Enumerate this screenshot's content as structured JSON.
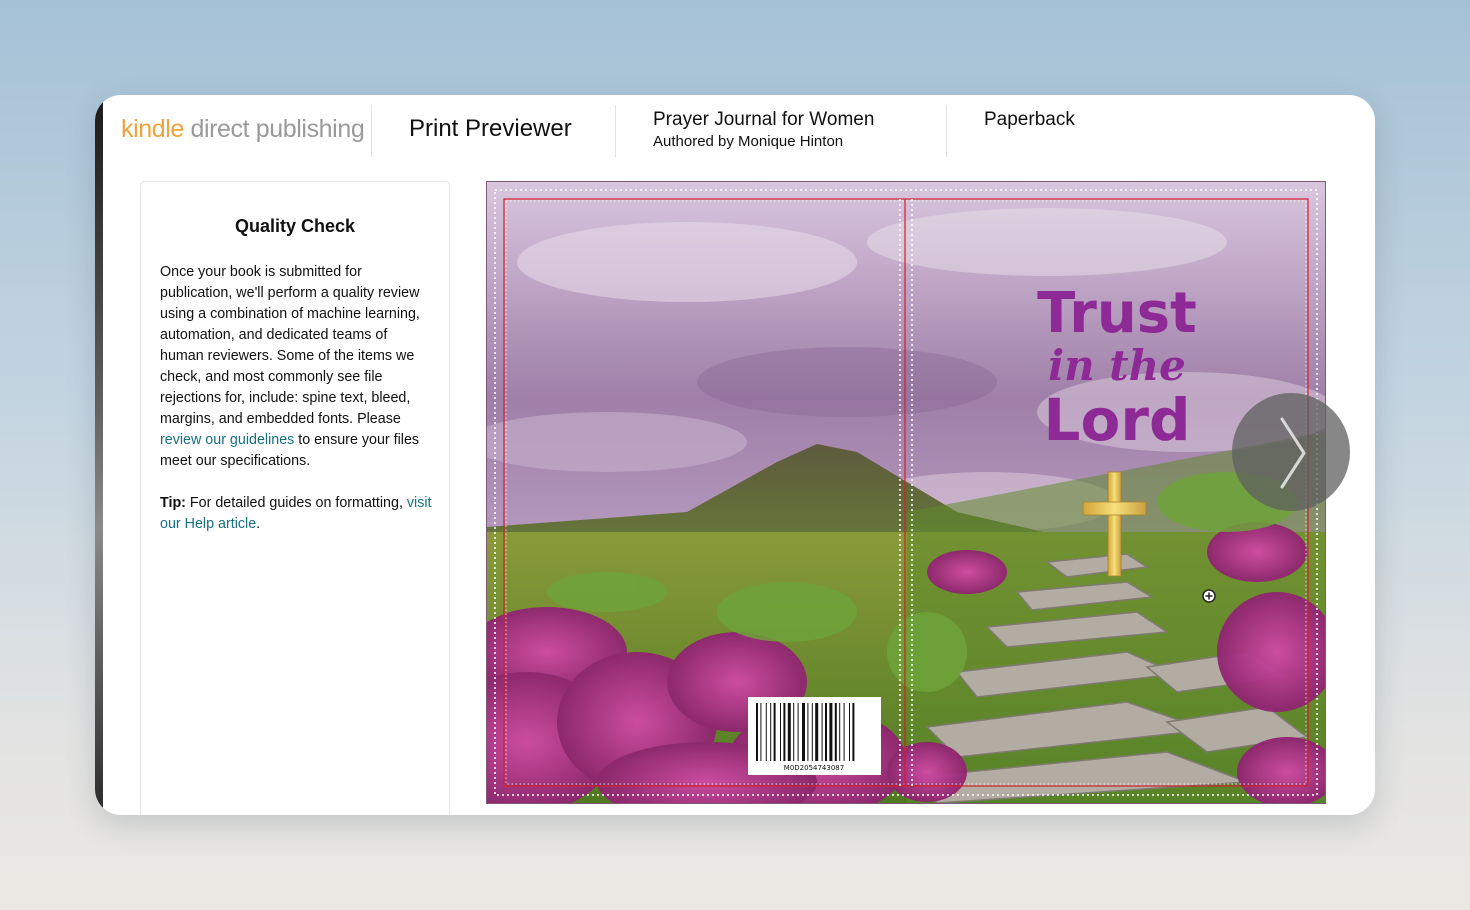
{
  "header": {
    "logo_kindle": "kindle",
    "logo_rest": " direct publishing",
    "app_title": "Print Previewer",
    "book_title": "Prayer Journal for Women",
    "book_author": "Authored by Monique Hinton",
    "format": "Paperback"
  },
  "quality_panel": {
    "heading": "Quality Check",
    "text_before_link": "Once your book is submitted for publication, we'll perform a quality review using a combination of machine learning, automation, and dedicated teams of human reviewers. Some of the items we check, and most commonly see file rejections for, include: spine text, bleed, margins, and embedded fonts. Please ",
    "guidelines_link": "review our guidelines",
    "text_after_link": " to ensure your files meet our specifications.",
    "tip_label": "Tip:",
    "tip_text": " For detailed guides on formatting, ",
    "help_link": "visit our Help article",
    "help_suffix": "."
  },
  "cover": {
    "title_line1": "Trust",
    "title_line2": "in the",
    "title_line3": "Lord",
    "barcode_number": "M0D2054743087",
    "title_color": "#8e2a96"
  },
  "navigation": {
    "next_icon": "chevron-right-icon",
    "zoom_icon": "plus-circle-icon"
  },
  "colors": {
    "logo_kindle": "#f0a33a",
    "logo_rest": "#9a9a9a",
    "link": "#16717f",
    "trim_line": "#d0202a"
  }
}
